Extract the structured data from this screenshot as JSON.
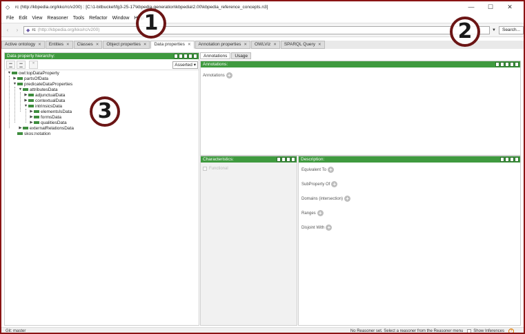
{
  "window": {
    "title": "rc (http://kbpedia.org/kko/rc/v200) : [C:\\1-bitbucket\\fg3-25-17\\kbpedia-generation\\kbpedia\\2.00\\kbpedia_reference_concepts.n3]",
    "controls": [
      "—",
      "☐",
      "✕"
    ]
  },
  "menu": [
    "File",
    "Edit",
    "View",
    "Reasoner",
    "Tools",
    "Refactor",
    "Window",
    "Help"
  ],
  "address": {
    "prefix": "rc",
    "value": "(http://kbpedia.org/kko/rc/v200)",
    "search_label": "Search..."
  },
  "tabs": [
    {
      "label": "Active ontology"
    },
    {
      "label": "Entities"
    },
    {
      "label": "Classes"
    },
    {
      "label": "Object properties"
    },
    {
      "label": "Data properties"
    },
    {
      "label": "Annotation properties"
    },
    {
      "label": "OWLViz"
    },
    {
      "label": "SPARQL Query"
    }
  ],
  "left_panel": {
    "title": "Data property hierarchy:",
    "mode": "Asserted",
    "tree": [
      {
        "label": "owl:topDataProperty",
        "level": 0,
        "arrow": "▼"
      },
      {
        "label": "partsOfData",
        "level": 1,
        "arrow": "▶"
      },
      {
        "label": "predicateDataProperties",
        "level": 1,
        "arrow": "▼"
      },
      {
        "label": "attributesData",
        "level": 2,
        "arrow": "▼"
      },
      {
        "label": "adjunctualData",
        "level": 3,
        "arrow": "▶"
      },
      {
        "label": "contextualData",
        "level": 3,
        "arrow": "▶"
      },
      {
        "label": "intrinsicsData",
        "level": 3,
        "arrow": "▼"
      },
      {
        "label": "elementsIsData",
        "level": 4,
        "arrow": "▶"
      },
      {
        "label": "formsData",
        "level": 4,
        "arrow": "▶"
      },
      {
        "label": "qualitiesData",
        "level": 4,
        "arrow": "▶"
      },
      {
        "label": "externalRelationsData",
        "level": 2,
        "arrow": "▶"
      },
      {
        "label": "skos:notation",
        "level": 1,
        "arrow": ""
      }
    ]
  },
  "right_panel": {
    "tabs": [
      "Annotations",
      "Usage"
    ],
    "annotations_title": "Annotations:",
    "annotations_label": "Annotations",
    "characteristics_title": "Characteristics:",
    "functional_label": "Functional",
    "description_title": "Description:",
    "description_rows": [
      "Equivalent To",
      "SubProperty Of",
      "Domains (intersection)",
      "Ranges",
      "Disjoint With"
    ]
  },
  "status": {
    "left": "Git: master",
    "reasoner": "No Reasoner set. Select a reasoner from the Reasoner menu",
    "show_inferences": "Show Inferences",
    "help": "?"
  },
  "callouts": [
    "1",
    "2",
    "3"
  ],
  "colors": {
    "panel_header": "#3f9a3f",
    "frame_border": "#8a1414",
    "callout_ring": "#6b1515"
  }
}
